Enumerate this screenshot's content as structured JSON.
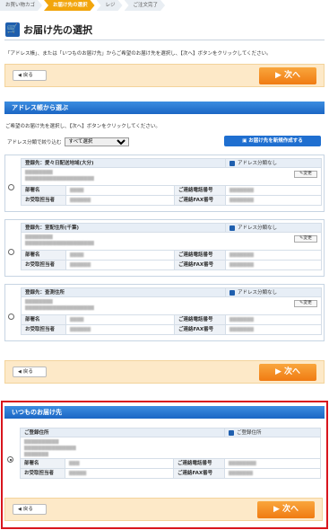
{
  "steps": [
    "お買い物カゴ",
    "お届け先の選択",
    "レジ",
    "ご注文完了"
  ],
  "title": "お届け先の選択",
  "intro": "「アドレス帳」、または「いつものお届け先」からご希望のお届け先を選択し、【次へ】ボタンをクリックしてください。",
  "nav": {
    "back": "戻る",
    "next": "次へ"
  },
  "address_book": {
    "heading": "アドレス帳から選ぶ",
    "desc": "ご希望のお届け先を選択し、【次へ】ボタンをクリックしてください。",
    "filter_label": "アドレス分類で絞り込む",
    "filter_value": "すべて選択",
    "new_button": "お届け先を新規作成する",
    "cards": [
      {
        "title": "登録先：愛々日配送地域(大分)",
        "category": "アドレス分類なし",
        "edit": "変更",
        "dept_label": "部署名",
        "person_label": "お受取担当者",
        "phone_label": "ご連絡電話番号",
        "fax_label": "ご連絡FAX番号"
      },
      {
        "title": "登録先：室配住所(千葉)",
        "category": "アドレス分類なし",
        "edit": "変更",
        "dept_label": "部署名",
        "person_label": "お受取担当者",
        "phone_label": "ご連絡電話番号",
        "fax_label": "ご連絡FAX番号"
      },
      {
        "title": "登録先：查測住所",
        "category": "アドレス分類なし",
        "edit": "変更",
        "dept_label": "部署名",
        "person_label": "お受取担当者",
        "phone_label": "ご連絡電話番号",
        "fax_label": "ご連絡FAX番号"
      }
    ]
  },
  "usual": {
    "heading": "いつものお届け先",
    "title": "ご登録住所",
    "category": "ご登録住所",
    "dept_label": "部署名",
    "person_label": "お受取担当者",
    "phone_label": "ご連絡電話番号",
    "fax_label": "ご連絡FAX番号"
  }
}
